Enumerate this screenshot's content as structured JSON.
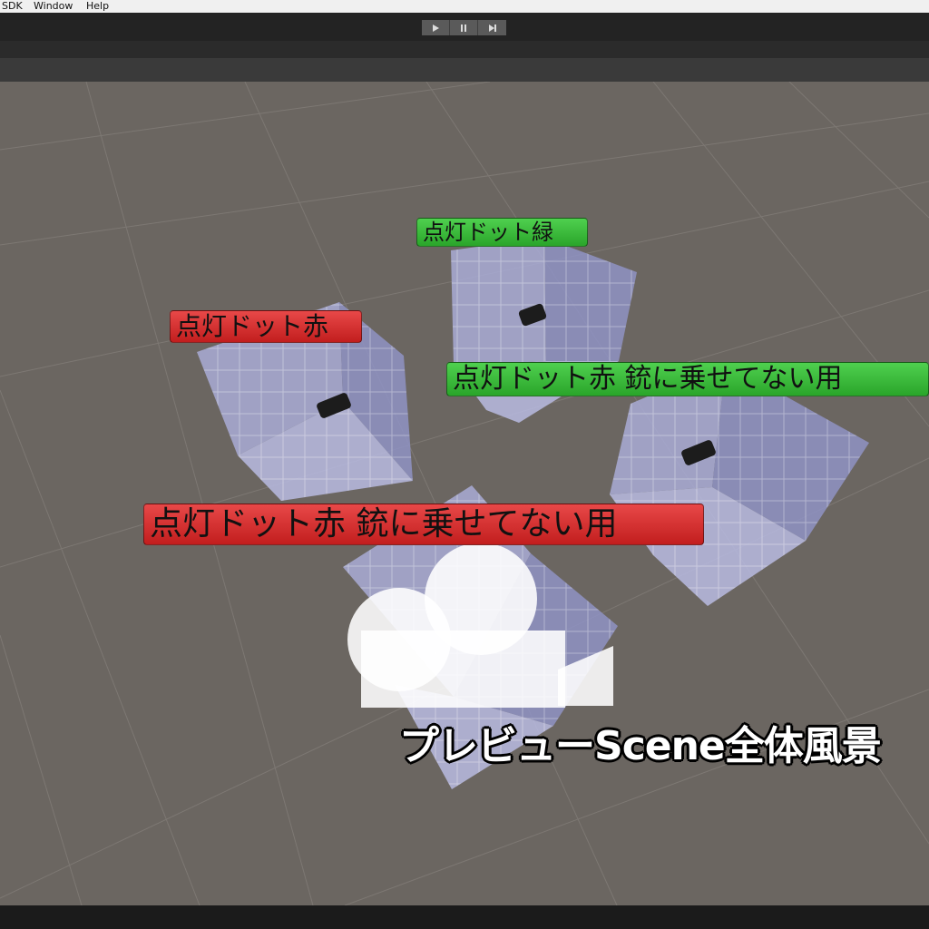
{
  "menu": {
    "items": [
      "SDK",
      "Window",
      "Help"
    ]
  },
  "toolbar": {
    "play_icon": "play-icon",
    "pause_icon": "pause-icon",
    "step_icon": "step-icon"
  },
  "scene": {
    "labels": {
      "green_top": "点灯ドット緑",
      "red_left": "点灯ドット赤",
      "green_right": "点灯ドット赤 銃に乗せてない用",
      "red_bottom": "点灯ドット赤 銃に乗せてない用"
    },
    "caption": "プレビューScene全体風景",
    "colors": {
      "background": "#6b6661",
      "cube_fill": "#a9acd6",
      "label_green": "#3cbf3c",
      "label_red": "#d83030"
    }
  }
}
